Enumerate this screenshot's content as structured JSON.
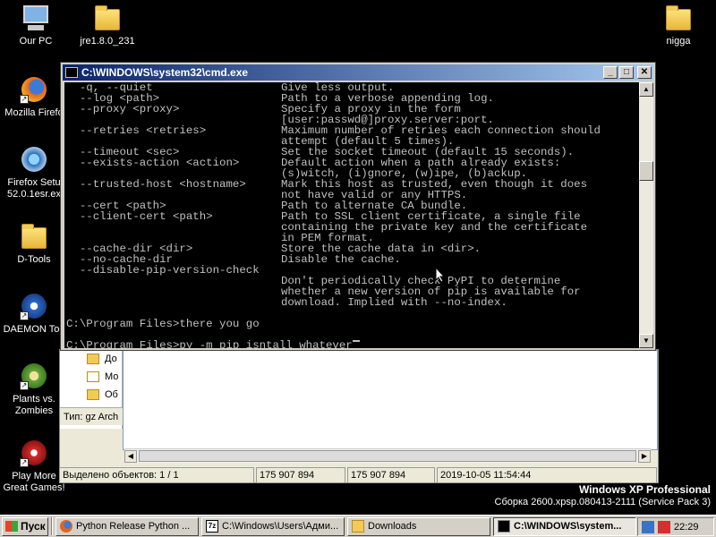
{
  "desktop": {
    "icons": [
      {
        "label": "Our PC",
        "icon": "computer-icon"
      },
      {
        "label": "jre1.8.0_231",
        "icon": "folder-icon"
      },
      {
        "label": "nigga",
        "icon": "folder-icon"
      },
      {
        "label": "Mozilla Firefo",
        "icon": "firefox-icon"
      },
      {
        "label_line1": "Firefox Setu",
        "label_line2": "52.0.1esr.ex",
        "icon": "installer-icon"
      },
      {
        "label": "D-Tools",
        "icon": "folder-icon"
      },
      {
        "label": "DAEMON Too",
        "icon": "daemon-tools-icon"
      },
      {
        "label_line1": "Plants vs.",
        "label_line2": "Zombies",
        "icon": "plants-vs-zombies-icon"
      },
      {
        "label_line1": "Play More",
        "label_line2": "Great Games!",
        "icon": "popcap-icon"
      }
    ]
  },
  "cmd": {
    "title": "C:\\WINDOWS\\system32\\cmd.exe",
    "lines": [
      {
        "left": "  -q, --quiet",
        "right": "Give less output."
      },
      {
        "left": "  --log <path>",
        "right": "Path to a verbose appending log."
      },
      {
        "left": "  --proxy <proxy>",
        "right": "Specify a proxy in the form"
      },
      {
        "left": "",
        "right": "[user:passwd@]proxy.server:port."
      },
      {
        "left": "  --retries <retries>",
        "right": "Maximum number of retries each connection should"
      },
      {
        "left": "",
        "right": "attempt (default 5 times)."
      },
      {
        "left": "  --timeout <sec>",
        "right": "Set the socket timeout (default 15 seconds)."
      },
      {
        "left": "  --exists-action <action>",
        "right": "Default action when a path already exists:"
      },
      {
        "left": "",
        "right": "(s)witch, (i)gnore, (w)ipe, (b)ackup."
      },
      {
        "left": "  --trusted-host <hostname>",
        "right": "Mark this host as trusted, even though it does"
      },
      {
        "left": "",
        "right": "not have valid or any HTTPS."
      },
      {
        "left": "  --cert <path>",
        "right": "Path to alternate CA bundle."
      },
      {
        "left": "  --client-cert <path>",
        "right": "Path to SSL client certificate, a single file"
      },
      {
        "left": "",
        "right": "containing the private key and the certificate"
      },
      {
        "left": "",
        "right": "in PEM format."
      },
      {
        "left": "  --cache-dir <dir>",
        "right": "Store the cache data in <dir>."
      },
      {
        "left": "  --no-cache-dir",
        "right": "Disable the cache."
      },
      {
        "left": "  --disable-pip-version-check",
        "right": ""
      },
      {
        "left": "",
        "right": "Don't periodically check PyPI to determine"
      },
      {
        "left": "",
        "right": "whether a new version of pip is available for"
      },
      {
        "left": "",
        "right": "download. Implied with --no-index."
      },
      {
        "left": "",
        "right": ""
      },
      {
        "left": "C:\\Program Files>there you go",
        "right": ""
      },
      {
        "left": "",
        "right": ""
      },
      {
        "left": "C:\\Program Files>py -m pip isntall whatever",
        "right": ""
      }
    ]
  },
  "explorer": {
    "items": [
      "До",
      "Мо",
      "Об"
    ],
    "type_label": "Тип: gz Arch",
    "status": {
      "selected": "Выделено объектов: 1 / 1",
      "size1": "175 907 894",
      "size2": "175 907 894",
      "date": "2019-10-05 11:54:44"
    }
  },
  "watermark": {
    "line1": "Windows XP Professional",
    "line2": "Сборка 2600.xpsp.080413-2111 (Service Pack 3)"
  },
  "taskbar": {
    "start_label": "Пуск",
    "tasks": [
      {
        "label": "Python Release Python ...",
        "icon": "firefox-icon",
        "active": false
      },
      {
        "label": "C:\\Windows\\Users\\Адми...",
        "icon": "7zip-icon",
        "active": false
      },
      {
        "label": "Downloads",
        "icon": "folder-icon",
        "active": false
      },
      {
        "label": "C:\\WINDOWS\\system...",
        "icon": "cmd-icon",
        "active": true
      }
    ],
    "clock": "22:29"
  },
  "colors": {
    "console_bg": "#000000",
    "console_fg": "#c0c0c0",
    "title_active": "#0a246a"
  }
}
